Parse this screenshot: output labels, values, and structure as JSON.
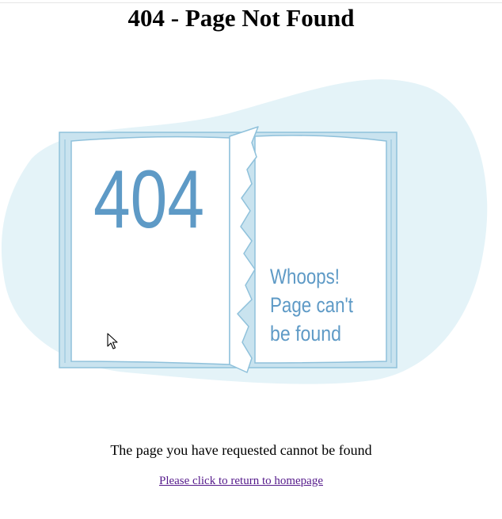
{
  "title": "404 - Page Not Found",
  "illustration": {
    "error_code": "404",
    "whoops_line1": "Whoops!",
    "whoops_line2": "Page can't",
    "whoops_line3": "be found"
  },
  "message": "The page you have requested cannot be found",
  "home_link": "Please click to return to homepage",
  "colors": {
    "blob": "#e4f3f8",
    "book_cover": "#c9e3ef",
    "book_outline": "#8fc1db",
    "digits": "#5e9ac6",
    "link_visited": "#551a8b"
  }
}
